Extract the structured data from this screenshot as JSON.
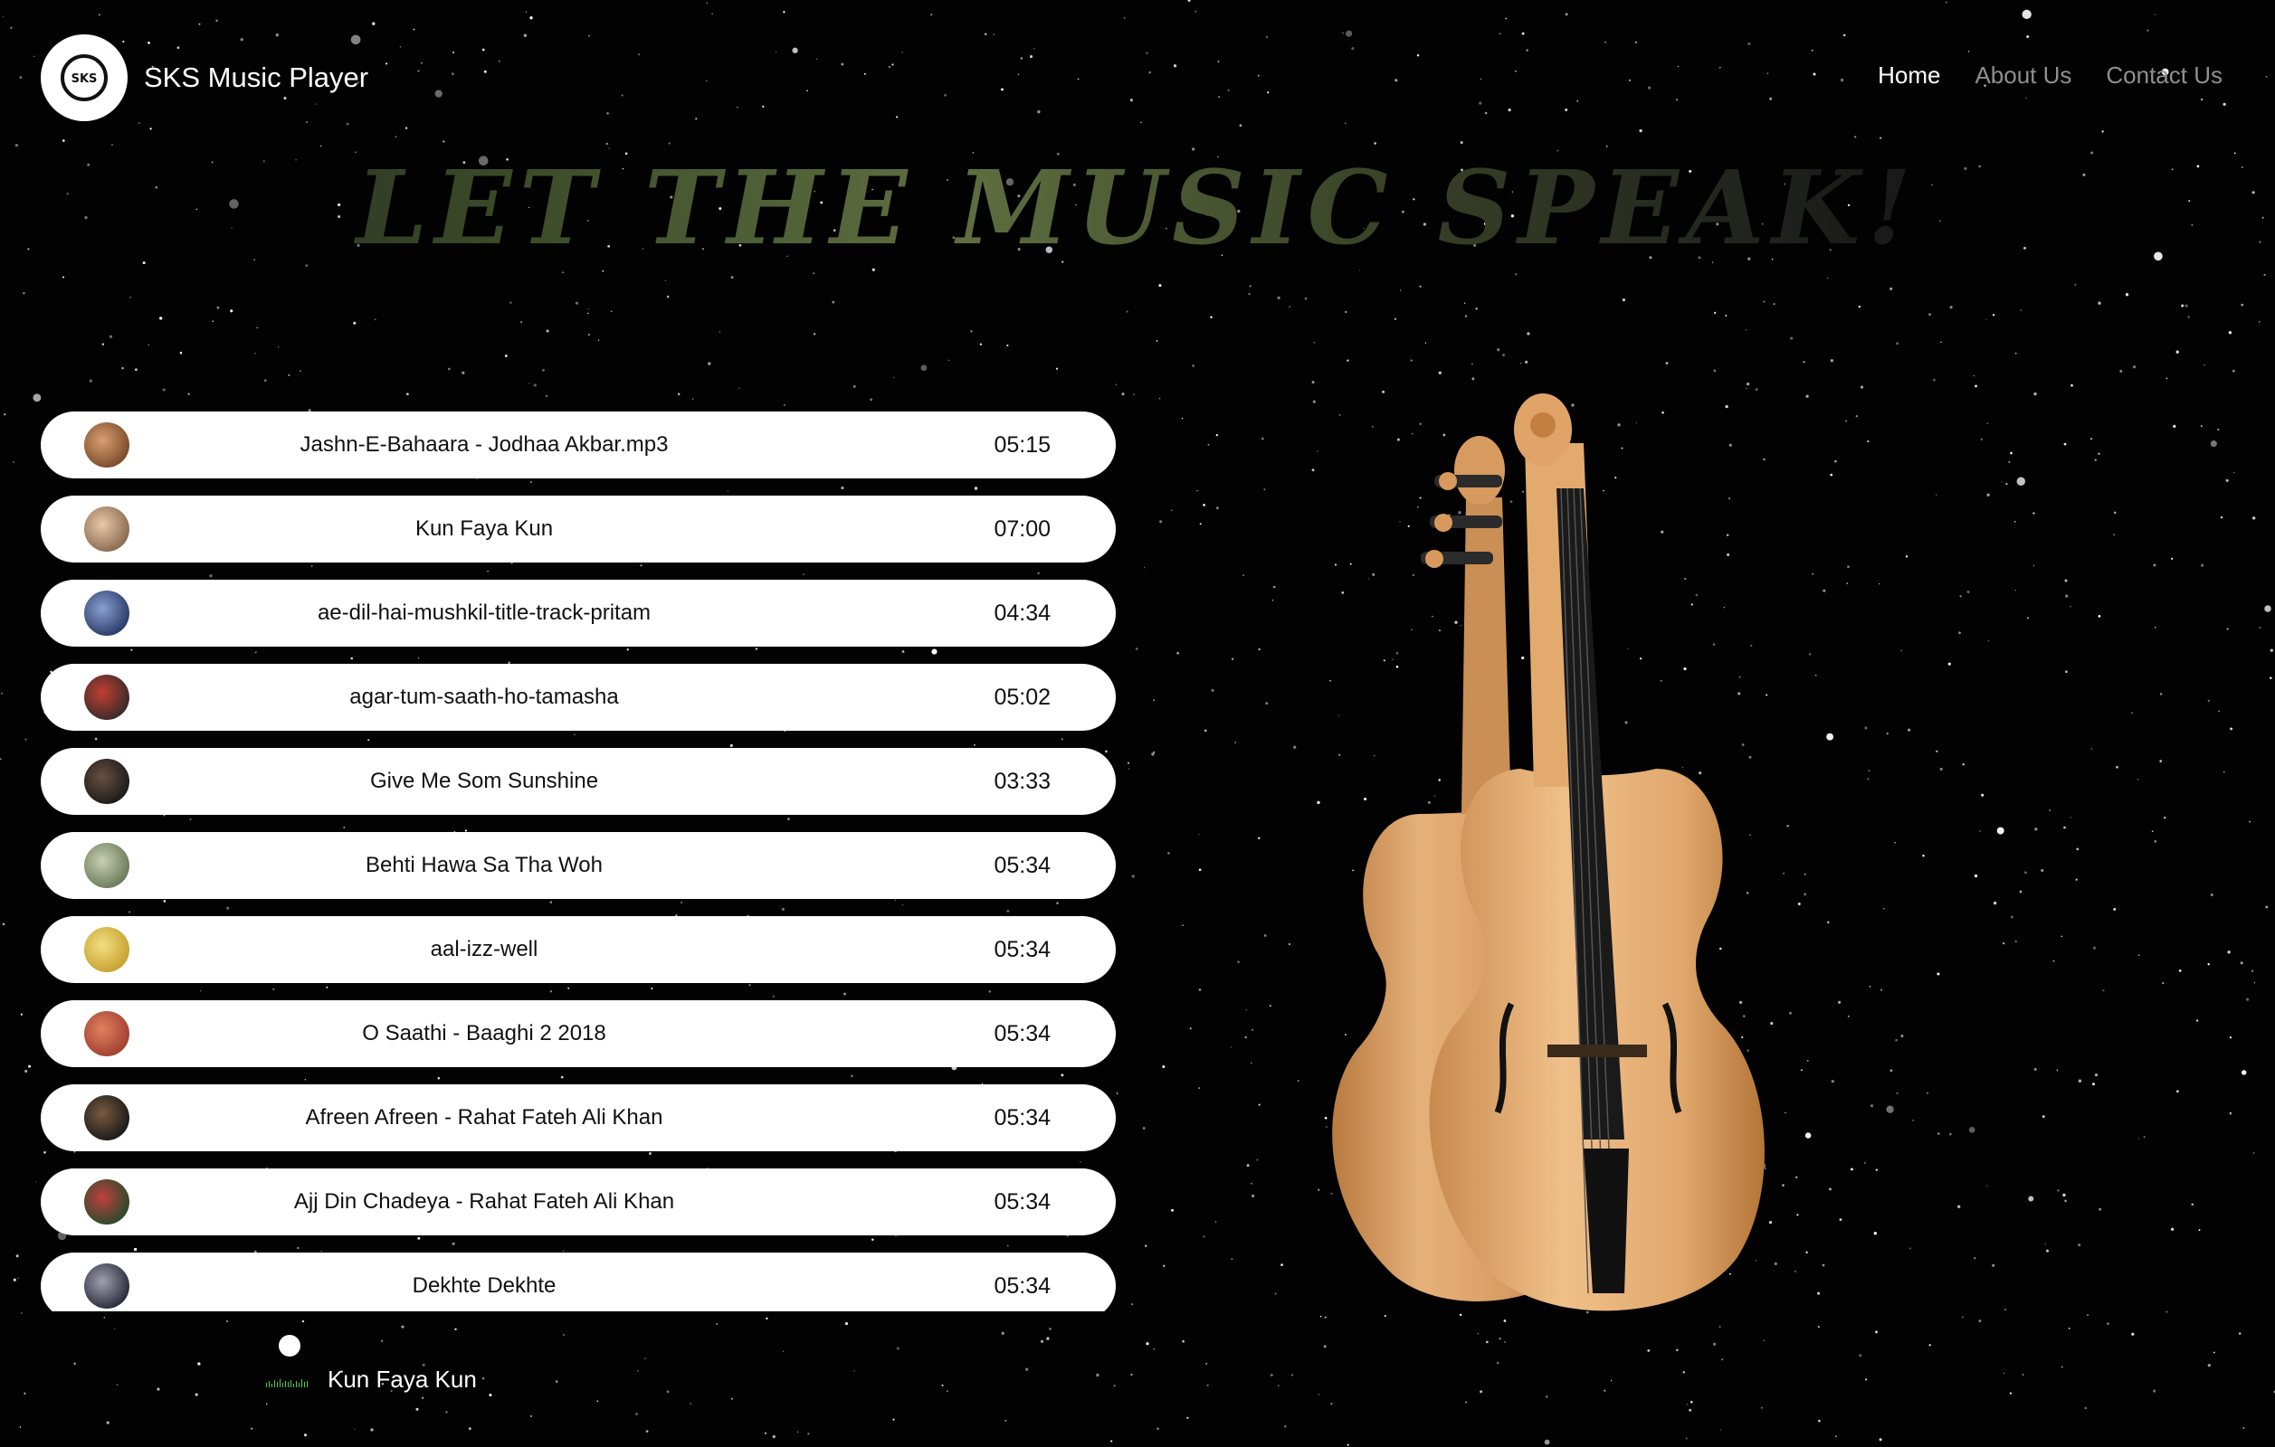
{
  "brand": {
    "logo_text": "SKS",
    "name": "SKS Music Player"
  },
  "nav": {
    "items": [
      {
        "label": "Home",
        "active": true
      },
      {
        "label": "About Us",
        "active": false
      },
      {
        "label": "Contact Us",
        "active": false
      }
    ]
  },
  "headline": "LET THE MUSIC SPEAK!",
  "songs": [
    {
      "name": "Jashn-E-Bahaara - Jodhaa Akbar.mp3",
      "duration": "05:15"
    },
    {
      "name": "Kun Faya Kun",
      "duration": "07:00"
    },
    {
      "name": "ae-dil-hai-mushkil-title-track-pritam",
      "duration": "04:34"
    },
    {
      "name": "agar-tum-saath-ho-tamasha",
      "duration": "05:02"
    },
    {
      "name": "Give Me Som Sunshine",
      "duration": "03:33"
    },
    {
      "name": "Behti Hawa Sa Tha Woh",
      "duration": "05:34"
    },
    {
      "name": "aal-izz-well",
      "duration": "05:34"
    },
    {
      "name": "O Saathi - Baaghi 2 2018",
      "duration": "05:34"
    },
    {
      "name": "Afreen Afreen - Rahat Fateh Ali Khan",
      "duration": "05:34"
    },
    {
      "name": "Ajj Din Chadeya - Rahat Fateh Ali Khan",
      "duration": "05:34"
    },
    {
      "name": "Dekhte Dekhte",
      "duration": "05:34"
    }
  ],
  "player": {
    "now_playing": "Kun Faya Kun",
    "progress": 0.0
  },
  "colors": {
    "background": "#020202",
    "accent_wave": "#4bd04b",
    "nav_inactive": "#8f8f8f",
    "nav_active": "#ffffff"
  }
}
